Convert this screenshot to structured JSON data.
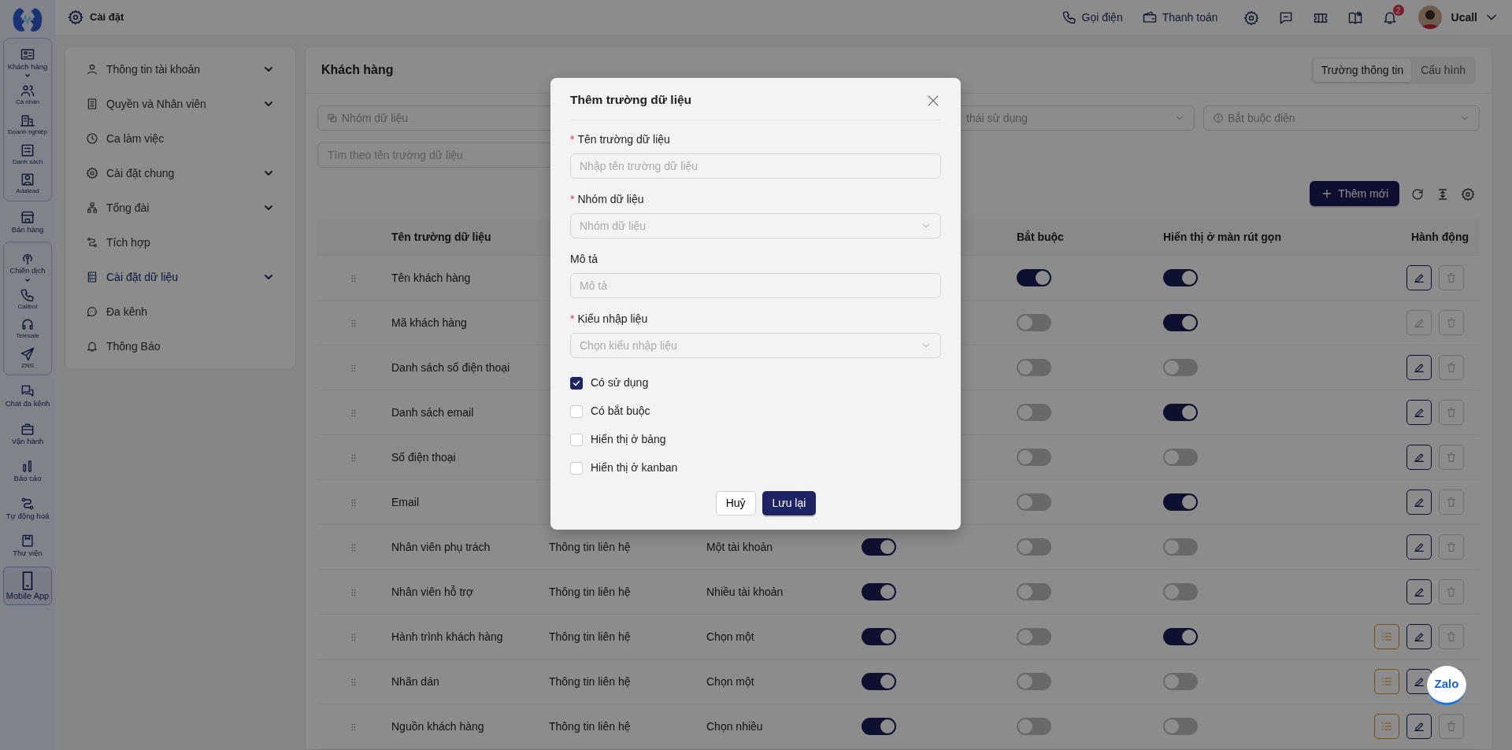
{
  "topbar": {
    "title": "Cài đặt",
    "actions": [
      "Gọi điện",
      "Thanh toán"
    ],
    "notification_count": "2",
    "user": "Ucall"
  },
  "rail": [
    {
      "kind": "group",
      "title": "Khách hàng",
      "expanded": true,
      "items": [
        "Cá nhân",
        "Doanh nghiệp",
        "Danh sách",
        "Adalead"
      ]
    },
    {
      "kind": "item",
      "label": "Bán hàng"
    },
    {
      "kind": "group",
      "title": "Chiến dịch",
      "expanded": true,
      "items": [
        "Callbot",
        "Telesale",
        "ZNS"
      ]
    },
    {
      "kind": "item",
      "label": "Chat đa kênh"
    },
    {
      "kind": "item",
      "label": "Vận hành"
    },
    {
      "kind": "item",
      "label": "Báo cáo"
    },
    {
      "kind": "item",
      "label": "Tự động hoá"
    },
    {
      "kind": "item",
      "label": "Thư viện"
    },
    {
      "kind": "framed",
      "label": "Mobile App"
    }
  ],
  "settings_menu": [
    {
      "label": "Thông tin tài khoản",
      "expandable": true,
      "selected": false
    },
    {
      "label": "Quyền và Nhân viên",
      "expandable": true,
      "selected": false
    },
    {
      "label": "Ca làm việc",
      "expandable": false,
      "selected": false
    },
    {
      "label": "Cài đặt chung",
      "expandable": true,
      "selected": false
    },
    {
      "label": "Tổng đài",
      "expandable": true,
      "selected": false
    },
    {
      "label": "Tích hợp",
      "expandable": false,
      "selected": false
    },
    {
      "label": "Cài đặt dữ liệu",
      "expandable": true,
      "selected": true
    },
    {
      "label": "Đa kênh",
      "expandable": false,
      "selected": false
    },
    {
      "label": "Thông Báo",
      "expandable": false,
      "selected": false
    }
  ],
  "content": {
    "title": "Khách hàng",
    "tabs": [
      {
        "label": "Trường thông tin",
        "selected": true
      },
      {
        "label": "Cấu hình",
        "selected": false
      }
    ],
    "filters": [
      {
        "placeholder": "Nhóm dữ liệu"
      },
      {
        "placeholder": "thái sử dụng"
      },
      {
        "placeholder": "Bắt buộc điền"
      }
    ],
    "search": {
      "placeholder": "Tìm theo tên trường dữ liệu"
    },
    "add_button": "Thêm mới"
  },
  "table": {
    "columns": [
      "Tên trường dữ liệu",
      "Bắt buộc",
      "Hiển thị ở màn rút gọn",
      "Hành động"
    ],
    "rows": [
      {
        "name": "Tên khách hàng",
        "required": true,
        "compact": true,
        "edit_disabled": false,
        "has_options": false
      },
      {
        "name": "Mã khách hàng",
        "required": false,
        "compact": true,
        "edit_disabled": true,
        "has_options": false
      },
      {
        "name": "Danh sách số điện thoại",
        "required": false,
        "compact": false,
        "edit_disabled": false,
        "has_options": false
      },
      {
        "name": "Danh sách email",
        "required": false,
        "compact": true,
        "edit_disabled": false,
        "has_options": false
      },
      {
        "name": "Số điện thoại",
        "required": false,
        "compact": false,
        "edit_disabled": false,
        "has_options": false
      },
      {
        "name": "Email",
        "required": false,
        "compact": true,
        "edit_disabled": false,
        "has_options": false
      },
      {
        "name": "Nhân viên phụ trách",
        "group": "Thông tin liên hệ",
        "type": "Một tài khoản",
        "used": true,
        "required": false,
        "compact": false,
        "edit_disabled": false,
        "has_options": false
      },
      {
        "name": "Nhân viên hỗ trợ",
        "group": "Thông tin liên hệ",
        "type": "Nhiều tài khoản",
        "used": true,
        "required": false,
        "compact": false,
        "edit_disabled": false,
        "has_options": false
      },
      {
        "name": "Hành trình khách hàng",
        "group": "Thông tin liên hệ",
        "type": "Chọn một",
        "used": true,
        "required": false,
        "compact": true,
        "edit_disabled": false,
        "has_options": true
      },
      {
        "name": "Nhãn dán",
        "group": "Thông tin liên hệ",
        "type": "Chọn một",
        "used": true,
        "required": false,
        "compact": false,
        "edit_disabled": false,
        "has_options": true
      },
      {
        "name": "Nguồn khách hàng",
        "group": "Thông tin liên hệ",
        "type": "Chọn nhiều",
        "used": true,
        "required": false,
        "compact": false,
        "edit_disabled": false,
        "has_options": true
      }
    ]
  },
  "modal": {
    "title": "Thêm trường dữ liệu",
    "fields": [
      {
        "label": "Tên trường dữ liệu",
        "required": true,
        "kind": "input",
        "placeholder": "Nhập tên trường dữ liệu"
      },
      {
        "label": "Nhóm dữ liệu",
        "required": true,
        "kind": "select",
        "placeholder": "Nhóm dữ liệu"
      },
      {
        "label": "Mô tả",
        "required": false,
        "kind": "input",
        "placeholder": "Mô tả"
      },
      {
        "label": "Kiểu nhập liệu",
        "required": true,
        "kind": "select",
        "placeholder": "Chọn kiểu nhập liệu"
      }
    ],
    "checkboxes": [
      {
        "label": "Có sử dụng",
        "checked": true
      },
      {
        "label": "Có bắt buộc",
        "checked": false
      },
      {
        "label": "Hiển thị ở bảng",
        "checked": false
      },
      {
        "label": "Hiển thị ở kanban",
        "checked": false
      }
    ],
    "required_mark": "*",
    "cancel": "Huỷ",
    "save": "Lưu lại"
  },
  "zalo_button": "Zalo"
}
